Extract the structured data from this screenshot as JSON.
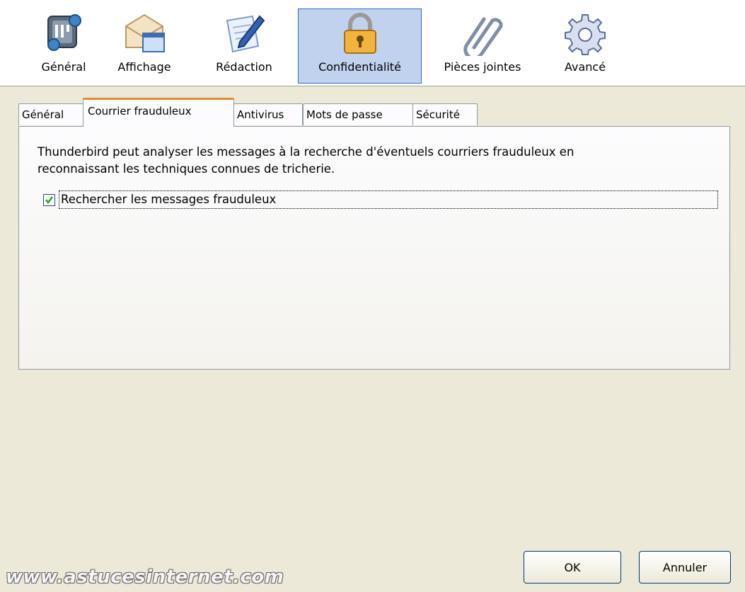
{
  "toolbar": {
    "panes": [
      {
        "label": "Général",
        "icon": "general-icon"
      },
      {
        "label": "Affichage",
        "icon": "display-icon"
      },
      {
        "label": "Rédaction",
        "icon": "compose-icon"
      },
      {
        "label": "Confidentialité",
        "icon": "lock-icon",
        "selected": true
      },
      {
        "label": "Pièces jointes",
        "icon": "paperclip-icon"
      },
      {
        "label": "Avancé",
        "icon": "gear-icon"
      }
    ]
  },
  "tabs": [
    {
      "label": "Général"
    },
    {
      "label": "Courrier frauduleux",
      "selected": true
    },
    {
      "label": "Antivirus"
    },
    {
      "label": "Mots de passe"
    },
    {
      "label": "Sécurité"
    }
  ],
  "panel": {
    "description_line1": "Thunderbird peut analyser les messages à la recherche d'éventuels courriers frauduleux en",
    "description_line2": "reconnaissant les techniques connues de tricherie.",
    "checkbox": {
      "label": "Rechercher les messages frauduleux",
      "checked": true
    }
  },
  "buttons": {
    "ok_label": "OK",
    "cancel_label": "Annuler"
  },
  "watermark": "www.astucesinternet.com",
  "colors": {
    "selected_pane_bg": "#c1d2ee",
    "selected_tab_accent": "#e68b2c",
    "window_bg": "#ece9d8"
  }
}
